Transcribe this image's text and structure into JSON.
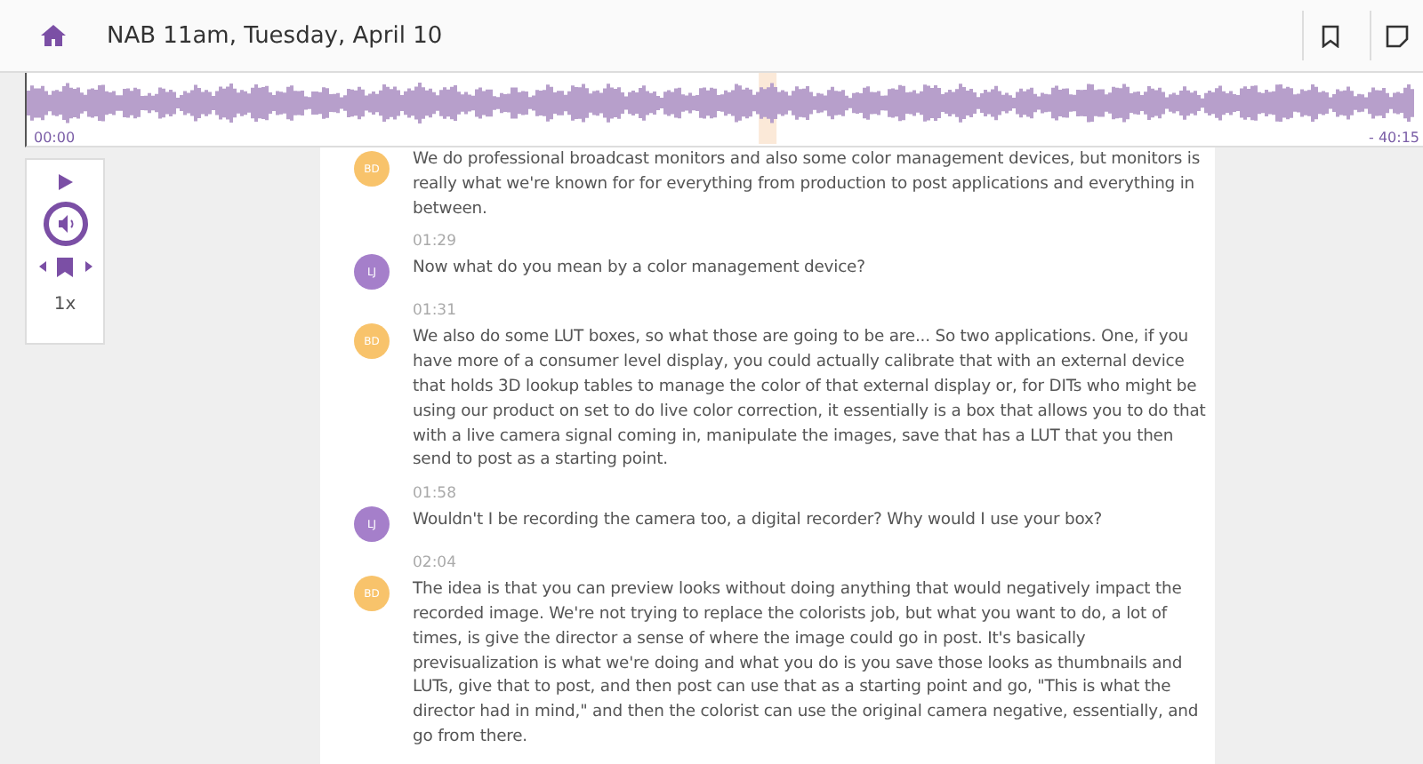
{
  "header": {
    "title": "NAB 11am, Tuesday, April 10"
  },
  "waveform": {
    "start": "00:00",
    "end": "- 40:15",
    "level": 0.53
  },
  "player": {
    "speed": "1x"
  },
  "entries": [
    {
      "initials": "BD",
      "color": "#f8c36b",
      "text": "We do professional broadcast monitors and also some color management devices, but monitors is really what we're known for for everything from production to post applications and everything in between."
    },
    {
      "time": "01:29",
      "initials": "LJ",
      "color": "#a57fca",
      "text": "Now what do you mean by a color management device?"
    },
    {
      "time": "01:31",
      "initials": "BD",
      "color": "#f8c36b",
      "text": "We also do some LUT boxes, so what those are going to be are... So two applications. One, if you have more of a consumer level display, you could actually calibrate that with an external device that holds 3D lookup tables to manage the color of that external display or, for DITs who might be using our product on set to do live color correction, it essentially is a box that allows you to do that with a live camera signal coming in, manipulate the images, save that has a LUT that you then send to post as a starting point."
    },
    {
      "time": "01:58",
      "initials": "LJ",
      "color": "#a57fca",
      "text": "Wouldn't I be recording the camera too, a digital recorder? Why would I use your box?"
    },
    {
      "time": "02:04",
      "initials": "BD",
      "color": "#f8c36b",
      "text": "The idea is that you can preview looks without doing anything that would negatively impact the recorded image. We're not trying to replace the colorists job, but what you want to do, a lot of times, is give the director a sense of where the image could go in post. It's basically previsualization is what we're doing and what you do is you save those looks as thumbnails and LUTs, give that to post, and then post can use that as a starting point and go, \"This is what the director had in mind,\" and then the colorist can use the original camera negative, essentially, and go from there."
    }
  ]
}
